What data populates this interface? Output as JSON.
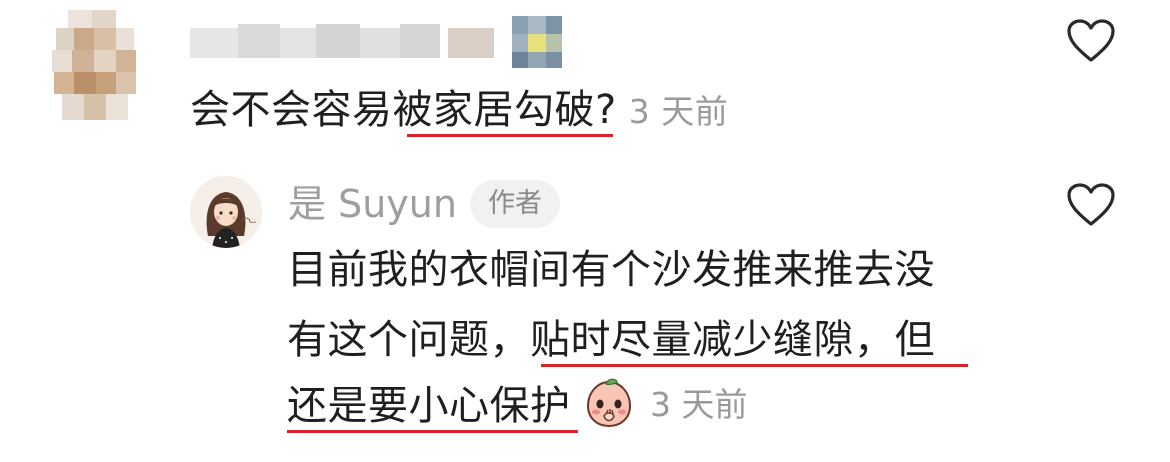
{
  "comment": {
    "text_plain": "会不会容易",
    "text_underlined": "被家居勾破?",
    "time": "3 天前",
    "like_icon": "heart-outline-icon",
    "avatar_icon": "pixelated-avatar",
    "username_icon": "pixelated-username"
  },
  "reply": {
    "author_name": "是 Suyun",
    "author_tag": "作者",
    "line1": "目前我的衣帽间有个沙发推来推去没",
    "line2_plain": "有这个问题，",
    "line2_underlined": "贴时尽量减少缝隙，但",
    "line3_underlined": "还是要小心保护",
    "time": "3 天前",
    "emoji_icon": "shy-peach-emoji-icon",
    "like_icon": "heart-outline-icon"
  },
  "colors": {
    "text": "#1f1f1f",
    "muted": "#9a9a9a",
    "underline": "#d8232a",
    "tag_bg": "#f1f1f1"
  }
}
